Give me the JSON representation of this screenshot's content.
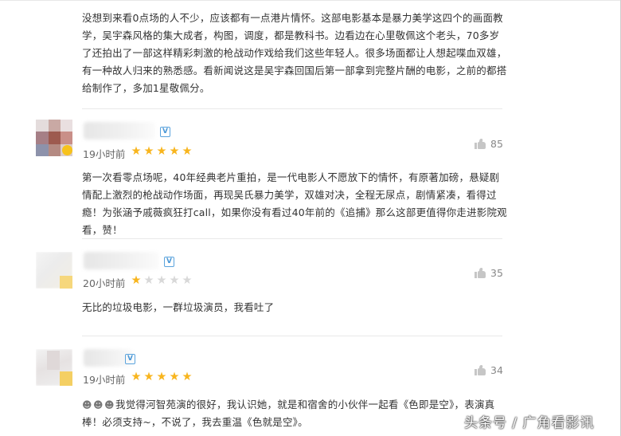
{
  "reviews": [
    {
      "text": "没想到来看0点场的人不少，应该都有一点港片情怀。这部电影基本是暴力美学这四个的画面教学，吴宇森风格的集大成者，构图，调度，都是教科书。边看边在心里敬佩这个老头，70多岁了还拍出了一部这样精彩刺激的枪战动作戏给我们这些年轻人。很多场面都让人想起喋血双雄，有一种故人归来的熟悉感。看新闻说这是吴宇森回国后第一部拿到完整片酬的电影，之前的都搭给制作了，多加1星敬佩分。"
    },
    {
      "time": "19小时前",
      "rating": 5,
      "likes": "85",
      "text": "第一次看零点场呢，40年经典老片重拍，是一代电影人不愿放下的情怀，有原著加磅，悬疑剧情配上激烈的枪战动作场面，再现吴氏暴力美学，双雄对决，全程无尿点，剧情紧凑，看得过瘾！为张涵予戚薇疯狂打call，如果你没有看过40年前的《追捕》那么这部更值得你走进影院观看，赞！"
    },
    {
      "time": "20小时前",
      "rating": 1,
      "likes": "35",
      "text": "无比的垃圾电影，一群垃圾演员，我看吐了"
    },
    {
      "time": "19小时前",
      "rating": 5,
      "likes": "34",
      "text": "我觉得河智苑演的很好，我认识她，就是和宿舍的小伙伴一起看《色即是空》，表演真棒！必须支持~，不说了，我去重温《色就是空》。"
    }
  ],
  "icons": {
    "like": "thumbs-up-icon",
    "vip": "vip-badge-icon",
    "star_on_color": "#f8b51e",
    "star_off_color": "#d8d8d8",
    "clap": "clapping-hands-emoji"
  },
  "watermark": "头条号 / 广角看影讯"
}
